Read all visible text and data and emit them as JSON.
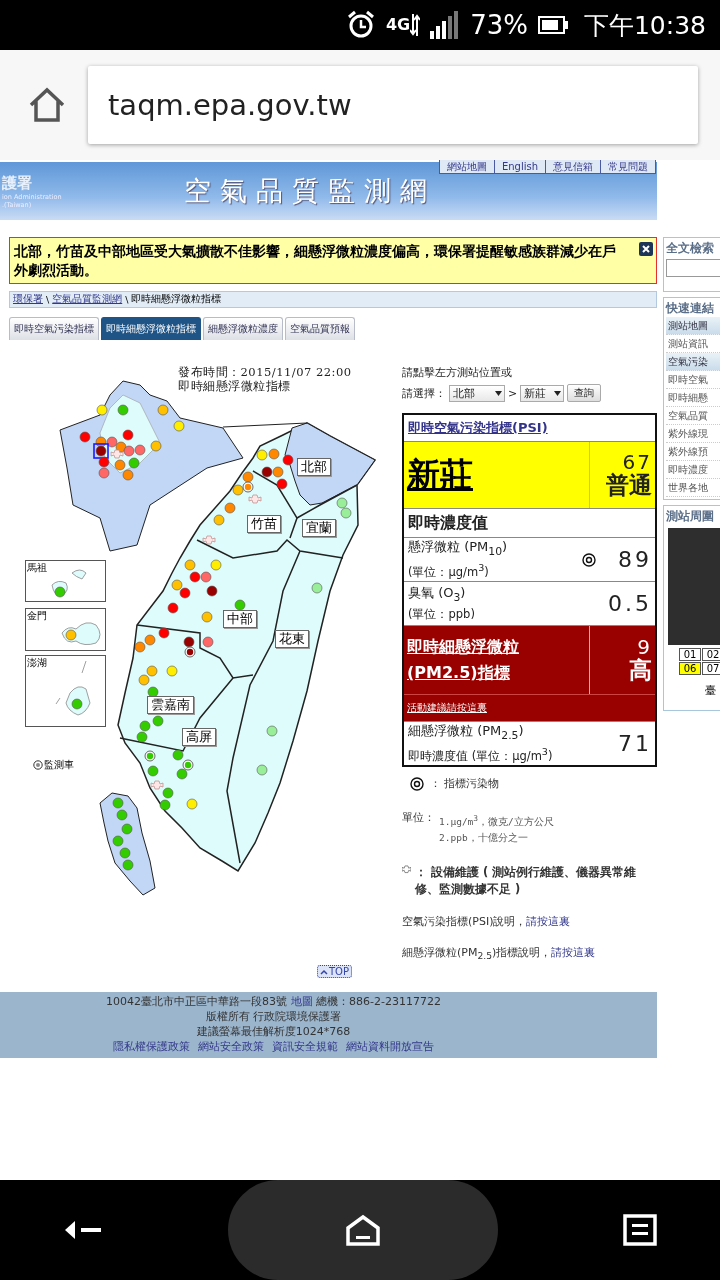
{
  "status_bar": {
    "network": "4G",
    "battery": "73%",
    "time": "下午10:38"
  },
  "browser": {
    "url": "taqm.epa.gov.tw"
  },
  "site_header": {
    "logo_lines": [
      "護署",
      "ion Administration",
      ".(Taiwan)"
    ],
    "title": "空氣品質監測網",
    "top_links": [
      "網站地圖",
      "English",
      "意見信箱",
      "常見問題"
    ]
  },
  "alert": {
    "text": "北部，竹苗及中部地區受大氣擴散不佳影響，細懸浮微粒濃度偏高，環保署提醒敏感族群減少在戶外劇烈活動。"
  },
  "breadcrumb": [
    {
      "label": "環保署",
      "kind": "link"
    },
    {
      "label": "\\",
      "kind": "separator"
    },
    {
      "label": "空氣品質監測網",
      "kind": "link"
    },
    {
      "label": "\\",
      "kind": "separator"
    },
    {
      "label": "即時細懸浮微粒指標",
      "kind": "current"
    }
  ],
  "tabs": [
    {
      "label": "即時空氣污染指標",
      "selected": false
    },
    {
      "label": "即時細懸浮微粒指標",
      "selected": true
    },
    {
      "label": "細懸浮微粒濃度",
      "selected": false
    },
    {
      "label": "空氣品質預報",
      "selected": false
    }
  ],
  "map": {
    "title_lines": [
      "發布時間：2015/11/07 22:00",
      "即時細懸浮微粒指標"
    ],
    "regions": [
      "北部",
      "竹苗",
      "宜蘭",
      "中部",
      "花東",
      "雲嘉南",
      "高屏"
    ],
    "insets": [
      "馬祖",
      "金門",
      "澎湖"
    ],
    "legend": "監測車",
    "stations": [
      {
        "kind": "station",
        "color": "#ffee00",
        "selected": false
      },
      {
        "kind": "station",
        "color": "#33cc00",
        "selected": false
      },
      {
        "kind": "station",
        "color": "#ffc000",
        "selected": false
      },
      {
        "kind": "station",
        "color": "#ffee00",
        "selected": false
      },
      {
        "kind": "station",
        "color": "#ff0000",
        "selected": false
      },
      {
        "kind": "station",
        "color": "#ff8800",
        "selected": false
      },
      {
        "kind": "station",
        "color": "#ff6666",
        "selected": false
      },
      {
        "kind": "station",
        "color": "#ff0000",
        "selected": false
      },
      {
        "kind": "station",
        "color": "#ff8800",
        "selected": false
      },
      {
        "kind": "station",
        "color": "#990000",
        "selected": true
      },
      {
        "kind": "station",
        "color": "#ff6666",
        "selected": false
      },
      {
        "kind": "station",
        "color": "#ff6666",
        "selected": false
      },
      {
        "kind": "station",
        "color": "#ffc000",
        "selected": false
      },
      {
        "kind": "maintenance",
        "selected": false
      },
      {
        "kind": "station",
        "color": "#ff0000",
        "selected": false
      },
      {
        "kind": "station",
        "color": "#ff8800",
        "selected": false
      },
      {
        "kind": "station",
        "color": "#33cc00",
        "selected": false
      },
      {
        "kind": "station",
        "color": "#ff6666",
        "selected": false
      },
      {
        "kind": "station",
        "color": "#ff8800",
        "selected": false
      },
      {
        "kind": "station",
        "color": "#ffee00",
        "selected": false
      },
      {
        "kind": "station",
        "color": "#ff8800",
        "selected": false
      },
      {
        "kind": "station",
        "color": "#ff0000",
        "selected": false
      },
      {
        "kind": "station",
        "color": "#990000",
        "selected": false
      },
      {
        "kind": "station",
        "color": "#ff8800",
        "selected": false
      },
      {
        "kind": "station",
        "color": "#ff0000",
        "selected": false
      },
      {
        "kind": "station",
        "color": "#ff8800",
        "selected": false
      },
      {
        "kind": "mobile",
        "color": "#ff8800",
        "selected": false
      },
      {
        "kind": "station",
        "color": "#ffc000",
        "selected": false
      },
      {
        "kind": "maintenance",
        "selected": false
      },
      {
        "kind": "station",
        "color": "#ff8800",
        "selected": false
      },
      {
        "kind": "station",
        "color": "#ffc000",
        "selected": false
      },
      {
        "kind": "maintenance",
        "selected": false
      },
      {
        "kind": "station",
        "color": "#99ee99",
        "selected": false
      },
      {
        "kind": "station",
        "color": "#99ee99",
        "selected": false
      },
      {
        "kind": "station",
        "color": "#ffc000",
        "selected": false
      },
      {
        "kind": "station",
        "color": "#ffee00",
        "selected": false
      },
      {
        "kind": "station",
        "color": "#ff0000",
        "selected": false
      },
      {
        "kind": "station",
        "color": "#ff6666",
        "selected": false
      },
      {
        "kind": "station",
        "color": "#ffc000",
        "selected": false
      },
      {
        "kind": "station",
        "color": "#990000",
        "selected": false
      },
      {
        "kind": "station",
        "color": "#ff0000",
        "selected": false
      },
      {
        "kind": "station",
        "color": "#33cc00",
        "selected": false
      },
      {
        "kind": "station",
        "color": "#ff0000",
        "selected": false
      },
      {
        "kind": "station",
        "color": "#ffc000",
        "selected": false
      },
      {
        "kind": "station",
        "color": "#99ee99",
        "selected": false
      },
      {
        "kind": "station",
        "color": "#ff0000",
        "selected": false
      },
      {
        "kind": "station",
        "color": "#ff8800",
        "selected": false
      },
      {
        "kind": "station",
        "color": "#ff8800",
        "selected": false
      },
      {
        "kind": "station",
        "color": "#990000",
        "selected": false
      },
      {
        "kind": "mobile",
        "color": "#990000",
        "selected": false
      },
      {
        "kind": "station",
        "color": "#ff6666",
        "selected": false
      },
      {
        "kind": "station",
        "color": "#ffc000",
        "selected": false
      },
      {
        "kind": "station",
        "color": "#ffee00",
        "selected": false
      },
      {
        "kind": "station",
        "color": "#ffc000",
        "selected": false
      },
      {
        "kind": "station",
        "color": "#33cc00",
        "selected": false
      },
      {
        "kind": "station",
        "color": "#33cc00",
        "selected": false
      },
      {
        "kind": "station",
        "color": "#33cc00",
        "selected": false
      },
      {
        "kind": "station",
        "color": "#33cc00",
        "selected": false
      },
      {
        "kind": "station",
        "color": "#99ee99",
        "selected": false
      },
      {
        "kind": "mobile",
        "color": "#33cc00",
        "selected": false
      },
      {
        "kind": "station",
        "color": "#33cc00",
        "selected": false
      },
      {
        "kind": "mobile",
        "color": "#33cc00",
        "selected": false
      },
      {
        "kind": "station",
        "color": "#33cc00",
        "selected": false
      },
      {
        "kind": "station",
        "color": "#33cc00",
        "selected": false
      },
      {
        "kind": "station",
        "color": "#99ee99",
        "selected": false
      },
      {
        "kind": "maintenance",
        "selected": false
      },
      {
        "kind": "station",
        "color": "#33cc00",
        "selected": false
      },
      {
        "kind": "station",
        "color": "#ffee00",
        "selected": false
      },
      {
        "kind": "station",
        "color": "#33cc00",
        "selected": false
      },
      {
        "kind": "station",
        "color": "#33cc00",
        "selected": false
      },
      {
        "kind": "station",
        "color": "#33cc00",
        "selected": false
      },
      {
        "kind": "station",
        "color": "#33cc00",
        "selected": false
      },
      {
        "kind": "station",
        "color": "#33cc00",
        "selected": false
      },
      {
        "kind": "station",
        "color": "#33cc00",
        "selected": false
      },
      {
        "kind": "station",
        "color": "#33cc00",
        "selected": false
      },
      {
        "kind": "station",
        "color": "#33cc00",
        "selected": false
      },
      {
        "kind": "station",
        "color": "#ffc000",
        "selected": false
      },
      {
        "kind": "station",
        "color": "#33cc00",
        "selected": false
      }
    ]
  },
  "selector": {
    "prompt": "請點擊左方測站位置或",
    "label": "請選擇：",
    "region": "北部",
    "arrow": ">",
    "station": "新莊",
    "button": "查詢"
  },
  "readings": {
    "psi_link": "即時空氣污染指標(PSI)",
    "station": "新莊",
    "psi_value": "67",
    "psi_status": "普通",
    "section": "即時濃度值",
    "pollutants": [
      {
        "name": "懸浮微粒 (PM$_{10}$)",
        "unit": "(單位：μg/m$^{3}$)",
        "indicator": true,
        "value": "89"
      },
      {
        "name": "臭氧 (O$_{3}$)",
        "unit": "(單位：ppb)",
        "indicator": false,
        "value": "0.5"
      }
    ],
    "pm25_link": "即時細懸浮微粒(PM2.5)指標",
    "pm25_value": "9",
    "pm25_status": "高",
    "advice_link": "活動建議請按這裏",
    "pm25_name": "細懸浮微粒 (PM$_{2.5}$)",
    "pm25_unit": "即時濃度值 (單位：μg/m$^{3}$)",
    "pm25_reading": "71"
  },
  "notes": {
    "indicator": "： 指標污染物",
    "unit_label": "單位：",
    "unit_lines": [
      "1.μg/m$^{3}$，微克/立方公尺",
      "2.ppb，十億分之一"
    ],
    "maintenance": "： 設備維護 ( 測站例行維護、儀器異常維修、監測數據不足 )",
    "explanations": [
      {
        "text": "空氣污染指標(PSI)說明，",
        "link": "請按這裏"
      },
      {
        "text": "細懸浮微粒(PM$_{2.5}$)指標說明，",
        "link": "請按這裏"
      }
    ]
  },
  "top_link": "TOP",
  "footer": {
    "address": "10042臺北市中正區中華路一段83號",
    "map_link": "地圖",
    "phone": "總機：886-2-23117722",
    "copyright": "版權所有  行政院環境保護署",
    "resolution": "建議螢幕最佳解析度1024*768",
    "links": [
      "隱私權保護政策",
      "網站安全政策",
      "資訊安全規範",
      "網站資料開放宣告"
    ]
  },
  "sidebar": {
    "search_title": "全文檢索",
    "links_title": "快速連結",
    "links": [
      {
        "label": "測站地圖",
        "kind": "header"
      },
      {
        "label": "測站資訊",
        "kind": "item"
      },
      {
        "label": "空氣污染",
        "kind": "header"
      },
      {
        "label": "即時空氣",
        "kind": "item"
      },
      {
        "label": "即時細懸",
        "kind": "item"
      },
      {
        "label": "空氣品質",
        "kind": "item"
      },
      {
        "label": "紫外線現",
        "kind": "item"
      },
      {
        "label": "紫外線預",
        "kind": "item"
      },
      {
        "label": "即時濃度",
        "kind": "item"
      },
      {
        "label": "世界各地",
        "kind": "item"
      }
    ],
    "camera_title": "測站周圍",
    "camera_pages": [
      {
        "label": "01",
        "selected": false
      },
      {
        "label": "02",
        "selected": false
      },
      {
        "label": "06",
        "selected": true
      },
      {
        "label": "07",
        "selected": false
      }
    ],
    "camera_caption": "臺"
  }
}
